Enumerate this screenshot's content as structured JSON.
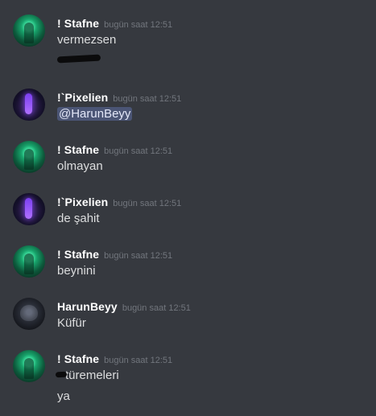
{
  "messages": [
    {
      "author": "! Stafne",
      "timestamp": "bugün saat 12:51",
      "avatar": "green-figure-avatar",
      "lines": [
        "vermezsen",
        ""
      ]
    },
    {
      "author": "!`Pixelien",
      "timestamp": "bugün saat 12:51",
      "avatar": "purple-figure-avatar",
      "mention": "@HarunBeyy"
    },
    {
      "author": "! Stafne",
      "timestamp": "bugün saat 12:51",
      "avatar": "green-figure-avatar",
      "lines": [
        "olmayan"
      ]
    },
    {
      "author": "!`Pixelien",
      "timestamp": "bugün saat 12:51",
      "avatar": "purple-figure-avatar",
      "lines": [
        "de şahit"
      ]
    },
    {
      "author": "! Stafne",
      "timestamp": "bugün saat 12:51",
      "avatar": "green-figure-avatar",
      "lines": [
        "beynini"
      ]
    },
    {
      "author": "HarunBeyy",
      "timestamp": "bugün saat 12:51",
      "avatar": "dark-wolf-avatar",
      "lines": [
        "Küfür"
      ]
    },
    {
      "author": "! Stafne",
      "timestamp": "bugün saat 12:51",
      "avatar": "green-figure-avatar",
      "lines": [
        "türemeleri",
        "ya"
      ]
    }
  ],
  "colors": {
    "background": "#36393f",
    "username": "#ffffff",
    "timestamp": "#72767d",
    "text": "#dcddde",
    "mention_bg": "#4f5b93"
  }
}
